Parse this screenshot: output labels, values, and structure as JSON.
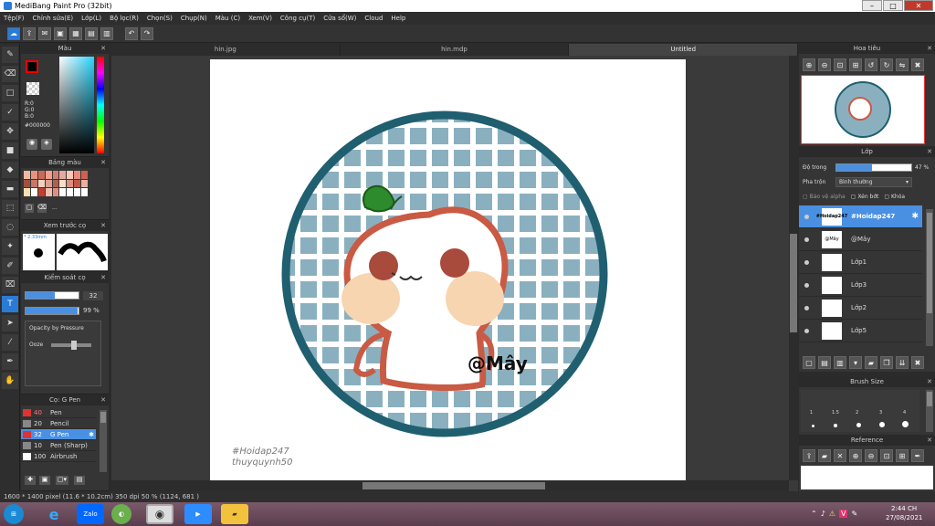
{
  "window": {
    "title": "MediBang Paint Pro (32bit)"
  },
  "menu": [
    "Tệp(F)",
    "Chỉnh sửa(E)",
    "Lớp(L)",
    "Bộ lọc(R)",
    "Chọn(S)",
    "Chụp(N)",
    "Màu (C)",
    "Xem(V)",
    "Công cụ(T)",
    "Cửa sổ(W)",
    "Cloud",
    "Help"
  ],
  "tabs": [
    "hin.jpg",
    "hin.mdp",
    "Untitled"
  ],
  "color_panel": {
    "title": "Màu",
    "r": "R:0",
    "g": "G:0",
    "b": "B:0",
    "hex": "#000000"
  },
  "palette_panel": {
    "title": "Bảng màu",
    "more": "..."
  },
  "preview_panel": {
    "title": "Xem trước cọ",
    "size": "* 2.33mm"
  },
  "brush_control": {
    "title": "Kiểm soát cọ",
    "size_value": "32",
    "opacity_value": "99 %",
    "opacity_fraction": 0.99,
    "pressure_label": "Opacity by Pressure",
    "ooze_label": "Ooze"
  },
  "brush_list": {
    "title": "Cọ: G Pen",
    "items": [
      {
        "size": "40",
        "name": "Pen",
        "color": "#d33"
      },
      {
        "size": "20",
        "name": "Pencil",
        "color": "#888"
      },
      {
        "size": "32",
        "name": "G Pen",
        "color": "#d33",
        "selected": true
      },
      {
        "size": "10",
        "name": "Pen (Sharp)",
        "color": "#888"
      },
      {
        "size": "100",
        "name": "Airbrush",
        "color": "#fff"
      }
    ]
  },
  "navigator": {
    "title": "Hoa tiêu"
  },
  "layer_panel": {
    "title": "Lớp",
    "opacity_label": "Độ trong",
    "opacity_value": "47 %",
    "opacity_fraction": 0.47,
    "blend_label": "Pha trộn",
    "blend_value": "Bình thường",
    "protect_alpha": "Bảo vệ alpha",
    "clipping": "Xén bớt",
    "lock": "Khóa",
    "layers": [
      {
        "name": "#Hoidap247",
        "thumb": "#Hoidap247",
        "selected": true
      },
      {
        "name": "@Mây",
        "thumb": "@Mây"
      },
      {
        "name": "Lớp1",
        "thumb": ""
      },
      {
        "name": "Lớp3",
        "thumb": ""
      },
      {
        "name": "Lớp2",
        "thumb": ""
      },
      {
        "name": "Lớp5",
        "thumb": ""
      }
    ]
  },
  "brush_size_panel": {
    "title": "Brush Size",
    "sizes": [
      "1",
      "1.5",
      "2",
      "3",
      "4"
    ]
  },
  "reference_panel": {
    "title": "Reference"
  },
  "artwork": {
    "signature": "@Mây",
    "watermark1": "#Hoidap247",
    "watermark2": "thuyquynh50"
  },
  "status": {
    "text": "1600 * 1400 pixel  (11.6 * 10.2cm)  350 dpi  50 %  (1124, 681 )"
  },
  "taskbar": {
    "time": "2:44 CH",
    "date": "27/08/2021",
    "zalo": "Zalo"
  },
  "colors": {
    "accent": "#4a90e2",
    "ring": "#1f5f70",
    "grid": "#8ab0c0",
    "stroke": "#c95a44",
    "cheek": "#f7d5b0"
  }
}
